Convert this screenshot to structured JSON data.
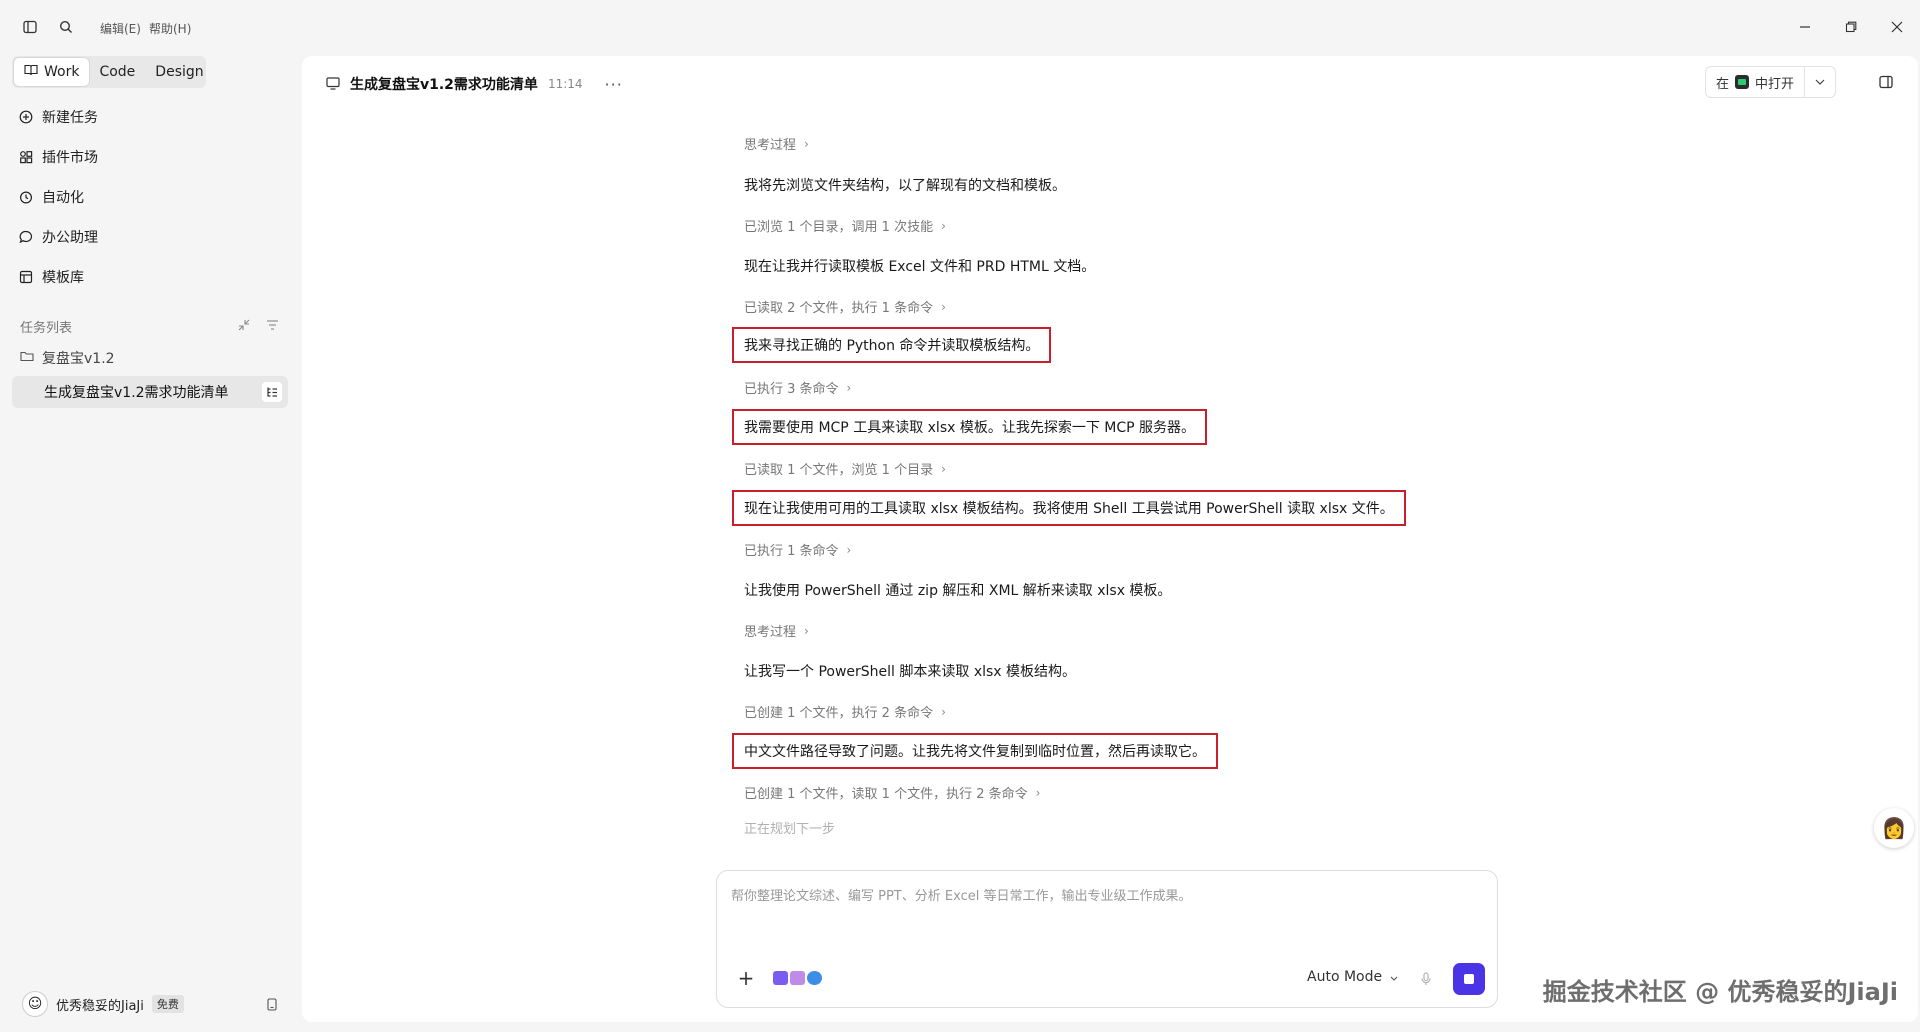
{
  "menu": {
    "edit": "编辑(E)",
    "help": "帮助(H)"
  },
  "modes": [
    {
      "label": "Work"
    },
    {
      "label": "Code"
    },
    {
      "label": "Design"
    }
  ],
  "nav": [
    {
      "label": "新建任务",
      "icon": "plus-circle-icon"
    },
    {
      "label": "插件市场",
      "icon": "grid-plugin-icon"
    },
    {
      "label": "自动化",
      "icon": "clock-icon"
    },
    {
      "label": "办公助理",
      "icon": "chat-icon"
    },
    {
      "label": "模板库",
      "icon": "template-icon"
    }
  ],
  "task_list": {
    "label": "任务列表",
    "folder": "复盘宝v1.2",
    "active_task": "生成复盘宝v1.2需求功能清单"
  },
  "user": {
    "name": "优秀稳妥的JiaJi",
    "plan": "免费"
  },
  "header": {
    "title": "生成复盘宝v1.2需求功能清单",
    "time": "11:14",
    "more": "···",
    "open_prefix": "在",
    "open_suffix": "中打开"
  },
  "conversation": [
    {
      "type": "meta",
      "text": "思考过程"
    },
    {
      "type": "msg",
      "text": "我将先浏览文件夹结构，以了解现有的文档和模板。"
    },
    {
      "type": "meta",
      "text": "已浏览 1 个目录，调用 1 次技能"
    },
    {
      "type": "msg",
      "text": "现在让我并行读取模板 Excel 文件和 PRD HTML 文档。"
    },
    {
      "type": "meta",
      "text": "已读取 2 个文件，执行 1 条命令"
    },
    {
      "type": "msg",
      "text": "我来寻找正确的 Python 命令并读取模板结构。",
      "highlight": true
    },
    {
      "type": "meta",
      "text": "已执行 3 条命令"
    },
    {
      "type": "msg",
      "text": "我需要使用 MCP 工具来读取 xlsx 模板。让我先探索一下 MCP 服务器。",
      "highlight": true
    },
    {
      "type": "meta",
      "text": "已读取 1 个文件，浏览 1 个目录"
    },
    {
      "type": "msg",
      "text": "现在让我使用可用的工具读取 xlsx 模板结构。我将使用 Shell 工具尝试用 PowerShell 读取 xlsx 文件。",
      "highlight": true
    },
    {
      "type": "meta",
      "text": "已执行 1 条命令"
    },
    {
      "type": "msg",
      "text": "让我使用 PowerShell 通过 zip 解压和 XML 解析来读取 xlsx 模板。"
    },
    {
      "type": "meta",
      "text": "思考过程"
    },
    {
      "type": "msg",
      "text": "让我写一个 PowerShell 脚本来读取 xlsx 模板结构。"
    },
    {
      "type": "meta",
      "text": "已创建 1 个文件，执行 2 条命令"
    },
    {
      "type": "msg",
      "text": "中文文件路径导致了问题。让我先将文件复制到临时位置，然后再读取它。",
      "highlight": true
    },
    {
      "type": "meta",
      "text": "已创建 1 个文件，读取 1 个文件，执行 2 条命令"
    }
  ],
  "planning": "正在规划下一步",
  "composer": {
    "placeholder": "帮你整理论文综述、编写 PPT、分析 Excel 等日常工作，输出专业级工作成果。",
    "mode": "Auto Mode"
  },
  "watermark": "掘金技术社区 @ 优秀稳妥的JiaJi",
  "colors": {
    "accent": "#4b33e6",
    "highlight_border": "#c8202a"
  }
}
